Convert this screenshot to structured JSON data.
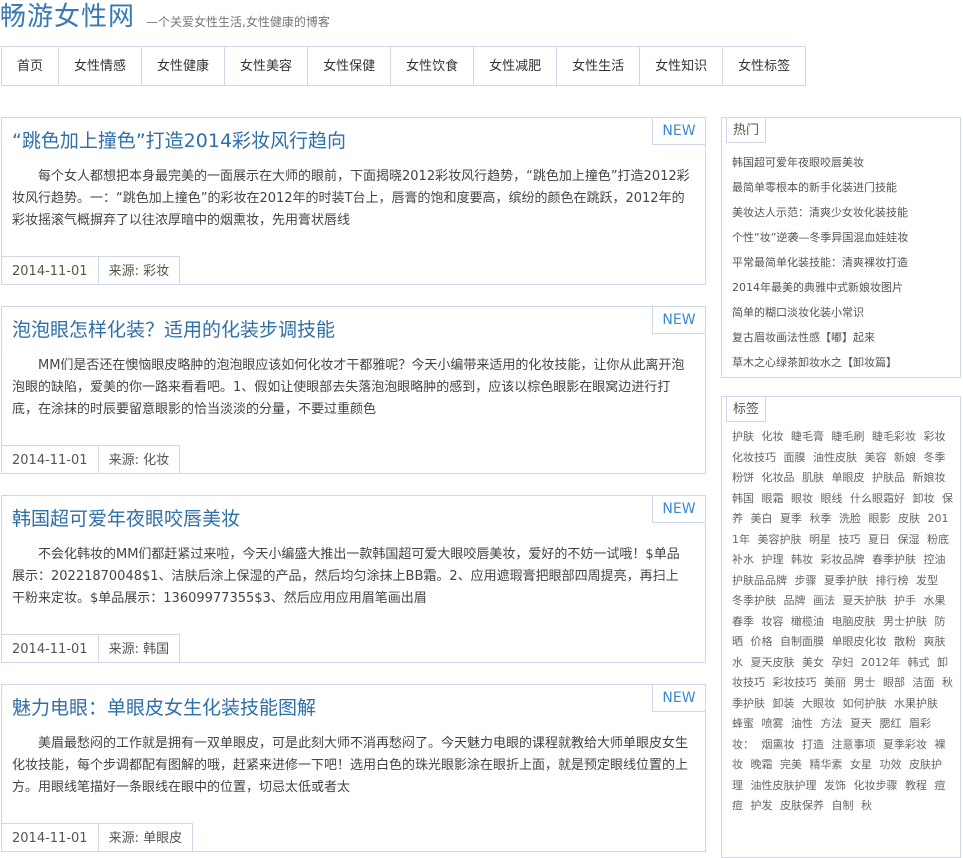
{
  "site": {
    "logo": "畅游女性网",
    "tagline": "—个关爱女性生活,女性健康的博客"
  },
  "nav": [
    "首页",
    "女性情感",
    "女性健康",
    "女性美容",
    "女性保健",
    "女性饮食",
    "女性减肥",
    "女性生活",
    "女性知识",
    "女性标签"
  ],
  "articles": [
    {
      "title": "“跳色加上撞色”打造2014彩妆风行趋向",
      "badge": "NEW",
      "excerpt": "每个女人都想把本身最完美的一面展示在大师的眼前，下面揭晓2012彩妆风行趋势，“跳色加上撞色”打造2012彩妆风行趋势。一：“跳色加上撞色”的彩妆在2012年的时装T台上，唇膏的饱和度要高，缤纷的颜色在跳跃，2012年的彩妆摇滚气概摒弃了以往浓厚暗中的烟熏妆，先用膏状唇线",
      "date": "2014-11-01",
      "source": "来源: 彩妆"
    },
    {
      "title": "泡泡眼怎样化装？适用的化装步调技能",
      "badge": "NEW",
      "excerpt": "MM们是否还在懊恼眼皮略肿的泡泡眼应该如何化妆才干都雅呢？今天小编带来适用的化妆技能，让你从此离开泡泡眼的缺陷，爱美的你一路来看看吧。1、假如让使眼部去失落泡泡眼略肿的感到，应该以棕色眼影在眼窝边进行打底，在涂抹的时辰要留意眼影的恰当淡淡的分量，不要过重颜色",
      "date": "2014-11-01",
      "source": "来源: 化妆"
    },
    {
      "title": "韩国超可爱年夜眼咬唇美妆",
      "badge": "NEW",
      "excerpt": "不会化韩妆的MM们都赶紧过来啦，今天小编盛大推出一款韩国超可爱大眼咬唇美妆，爱好的不妨一试哦！$单品展示：20221870048$1、洁肤后涂上保湿的产品，然后均匀涂抹上BB霜。2、应用遮瑕膏把眼部四周提亮，再扫上干粉来定妆。$单品展示：13609977355$3、然后应用应用眉笔画出眉",
      "date": "2014-11-01",
      "source": "来源: 韩国"
    },
    {
      "title": "魅力电眼：单眼皮女生化装技能图解",
      "badge": "NEW",
      "excerpt": "美眉最愁闷的工作就是拥有一双单眼皮，可是此刻大师不消再愁闷了。今天魅力电眼的课程就教给大师单眼皮女生化妆技能，每个步调都配有图解的哦，赶紧来进修一下吧！选用白色的珠光眼影涂在眼折上面，就是预定眼线位置的上方。用眼线笔描好一条眼线在眼中的位置，切忌太低或者太",
      "date": "2014-11-01",
      "source": "来源: 单眼皮"
    }
  ],
  "hot": {
    "title": "热门",
    "items": [
      "韩国超可爱年夜眼咬唇美妆",
      "最简单零根本的新手化装进门技能",
      "美妆达人示范：清爽少女妆化装技能",
      "个性“妆”逆袭—冬季异国混血娃娃妆",
      "平常最简单化装技能：清爽裸妆打造",
      "2014年最美的典雅中式新娘妆图片",
      "简单的糊口淡妆化装小常识",
      "复古眉妆画法性感【嘟】起来",
      "草木之心绿茶卸妆水之【卸妆篇】"
    ]
  },
  "tags": {
    "title": "标签",
    "items": [
      "护肤",
      "化妆",
      "睫毛膏",
      "睫毛刷",
      "睫毛彩妆",
      "彩妆",
      "化妆技巧",
      "面膜",
      "油性皮肤",
      "美容",
      "新娘",
      "冬季",
      "粉饼",
      "化妆品",
      "肌肤",
      "单眼皮",
      "护肤品",
      "新娘妆",
      "韩国",
      "眼霜",
      "眼妆",
      "眼线",
      "什么眼霜好",
      "卸妆",
      "保养",
      "美白",
      "夏季",
      "秋季",
      "洗脸",
      "眼影",
      "皮肤",
      "2011年",
      "美容护肤",
      "明星",
      "技巧",
      "夏日",
      "保湿",
      "粉底",
      "补水",
      "护理",
      "韩妆",
      "彩妆品牌",
      "春季护肤",
      "控油",
      "护肤品品牌",
      "步骤",
      "夏季护肤",
      "排行榜",
      "发型",
      "冬季护肤",
      "品牌",
      "画法",
      "夏天护肤",
      "护手",
      "水果",
      "春季",
      "妆容",
      "橄榄油",
      "电脑皮肤",
      "男士护肤",
      "防晒",
      "价格",
      "自制面膜",
      "单眼皮化妆",
      "散粉",
      "爽肤水",
      "夏天皮肤",
      "美女",
      "孕妇",
      "2012年",
      "韩式",
      "卸妆技巧",
      "彩妆技巧",
      "美丽",
      "男士",
      "眼部",
      "洁面",
      "秋季护肤",
      "卸装",
      "大眼妆",
      "如何护肤",
      "水果护肤",
      "蜂蜜",
      "喷雾",
      "油性",
      "方法",
      "夏天",
      "腮红",
      "眉彩",
      "妆：",
      "烟熏妆",
      "打造",
      "注意事项",
      "夏季彩妆",
      "裸妆",
      "晚霜",
      "完美",
      "精华素",
      "女星",
      "功效",
      "皮肤护理",
      "油性皮肤护理",
      "发饰",
      "化妆步骤",
      "教程",
      "痘痘",
      "护发",
      "皮肤保养",
      "自制",
      "秋"
    ]
  }
}
